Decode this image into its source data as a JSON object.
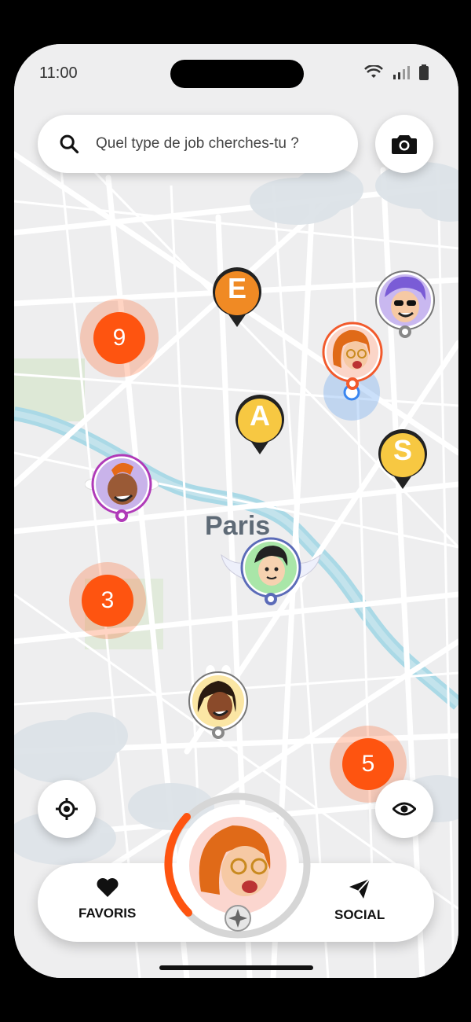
{
  "status": {
    "time": "11:00"
  },
  "search": {
    "placeholder": "Quel type de job cherches-tu ?"
  },
  "map": {
    "city_label": "Paris",
    "clusters": [
      {
        "count": "9"
      },
      {
        "count": "3"
      },
      {
        "count": "5"
      }
    ],
    "letter_pins": [
      {
        "letter": "E"
      },
      {
        "letter": "A"
      },
      {
        "letter": "S"
      }
    ]
  },
  "bottom_nav": {
    "favorites_label": "FAVORIS",
    "social_label": "SOCIAL"
  },
  "colors": {
    "accent": "#fe5410",
    "pin_orange": "#f08a24",
    "pin_yellow": "#f7c842",
    "water": "#aad9e6"
  },
  "icons": [
    "search-icon",
    "camera-icon",
    "locate-icon",
    "eye-icon",
    "heart-icon",
    "send-icon",
    "wifi-icon",
    "signal-icon",
    "battery-icon",
    "star-icon"
  ]
}
